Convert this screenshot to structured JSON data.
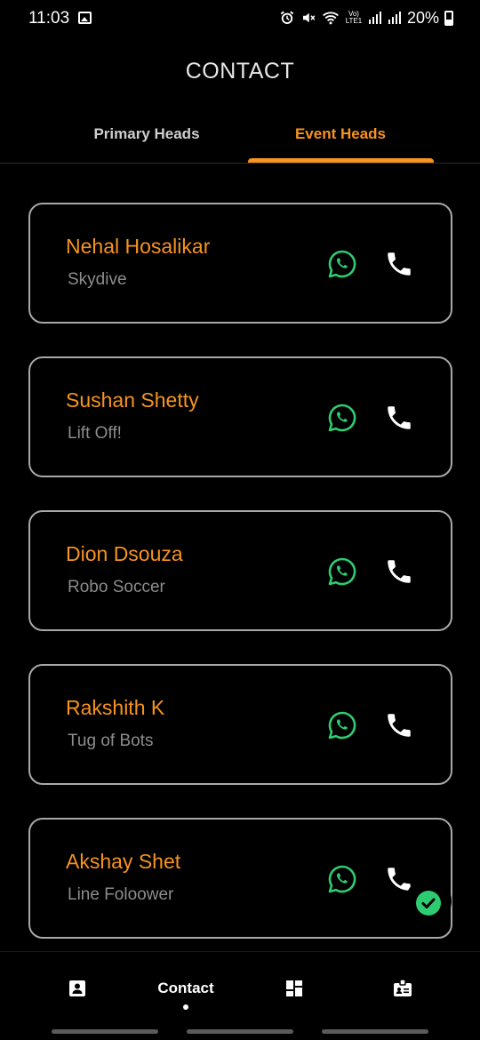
{
  "status_bar": {
    "time": "11:03",
    "battery_text": "20%",
    "network_label": "Vo) LTE1"
  },
  "header": {
    "title": "CONTACT"
  },
  "tabs": [
    {
      "label": "Primary Heads",
      "active": false
    },
    {
      "label": "Event Heads",
      "active": true
    }
  ],
  "contacts": [
    {
      "name": "Nehal Hosalikar",
      "event": "Skydive"
    },
    {
      "name": "Sushan Shetty",
      "event": "Lift Off!"
    },
    {
      "name": "Dion Dsouza",
      "event": "Robo Soccer"
    },
    {
      "name": "Rakshith K",
      "event": "Tug of Bots"
    },
    {
      "name": "Akshay Shet",
      "event": "Line Foloower"
    }
  ],
  "bottom_nav": {
    "items": [
      {
        "icon": "contact-card-icon",
        "label": ""
      },
      {
        "icon": "",
        "label": "Contact"
      },
      {
        "icon": "dashboard-icon",
        "label": ""
      },
      {
        "icon": "badge-icon",
        "label": ""
      }
    ]
  },
  "colors": {
    "accent": "#f7931e",
    "whatsapp": "#2ecc71",
    "card_border": "#a8a8a8",
    "background": "#000000"
  }
}
